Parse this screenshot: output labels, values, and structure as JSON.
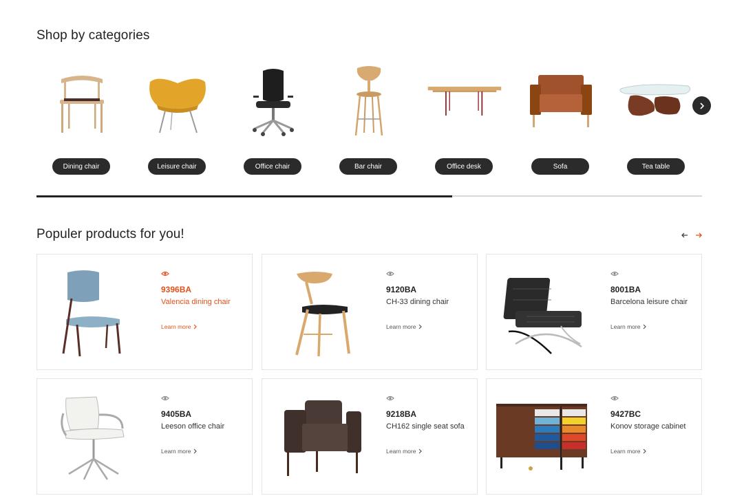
{
  "categories_section": {
    "title": "Shop by categories",
    "items": [
      {
        "label": "Dining chair",
        "icon": "dining-chair-icon"
      },
      {
        "label": "Leisure chair",
        "icon": "leisure-chair-icon"
      },
      {
        "label": "Office chair",
        "icon": "office-chair-icon"
      },
      {
        "label": "Bar chair",
        "icon": "bar-chair-icon"
      },
      {
        "label": "Office desk",
        "icon": "office-desk-icon"
      },
      {
        "label": "Sofa",
        "icon": "sofa-icon"
      },
      {
        "label": "Tea table",
        "icon": "tea-table-icon"
      }
    ],
    "next_icon": "chevron-right-icon",
    "scroll_progress": 0.625
  },
  "popular_section": {
    "title": "Populer products for you!",
    "prev_icon": "arrow-left-icon",
    "next_icon": "arrow-right-icon",
    "learn_more_label": "Learn more",
    "products": [
      {
        "code": "9396BA",
        "name": "Valencia dining chair",
        "active": true
      },
      {
        "code": "9120BA",
        "name": "CH-33 dining chair",
        "active": false
      },
      {
        "code": "8001BA",
        "name": "Barcelona leisure chair",
        "active": false
      },
      {
        "code": "9405BA",
        "name": "Leeson office chair",
        "active": false
      },
      {
        "code": "9218BA",
        "name": "CH162 single seat sofa",
        "active": false
      },
      {
        "code": "9427BC",
        "name": "Konov storage cabinet",
        "active": false
      }
    ]
  },
  "colors": {
    "accent": "#e0521a",
    "pill": "#2b2b2b",
    "border": "#e3e3e3"
  }
}
